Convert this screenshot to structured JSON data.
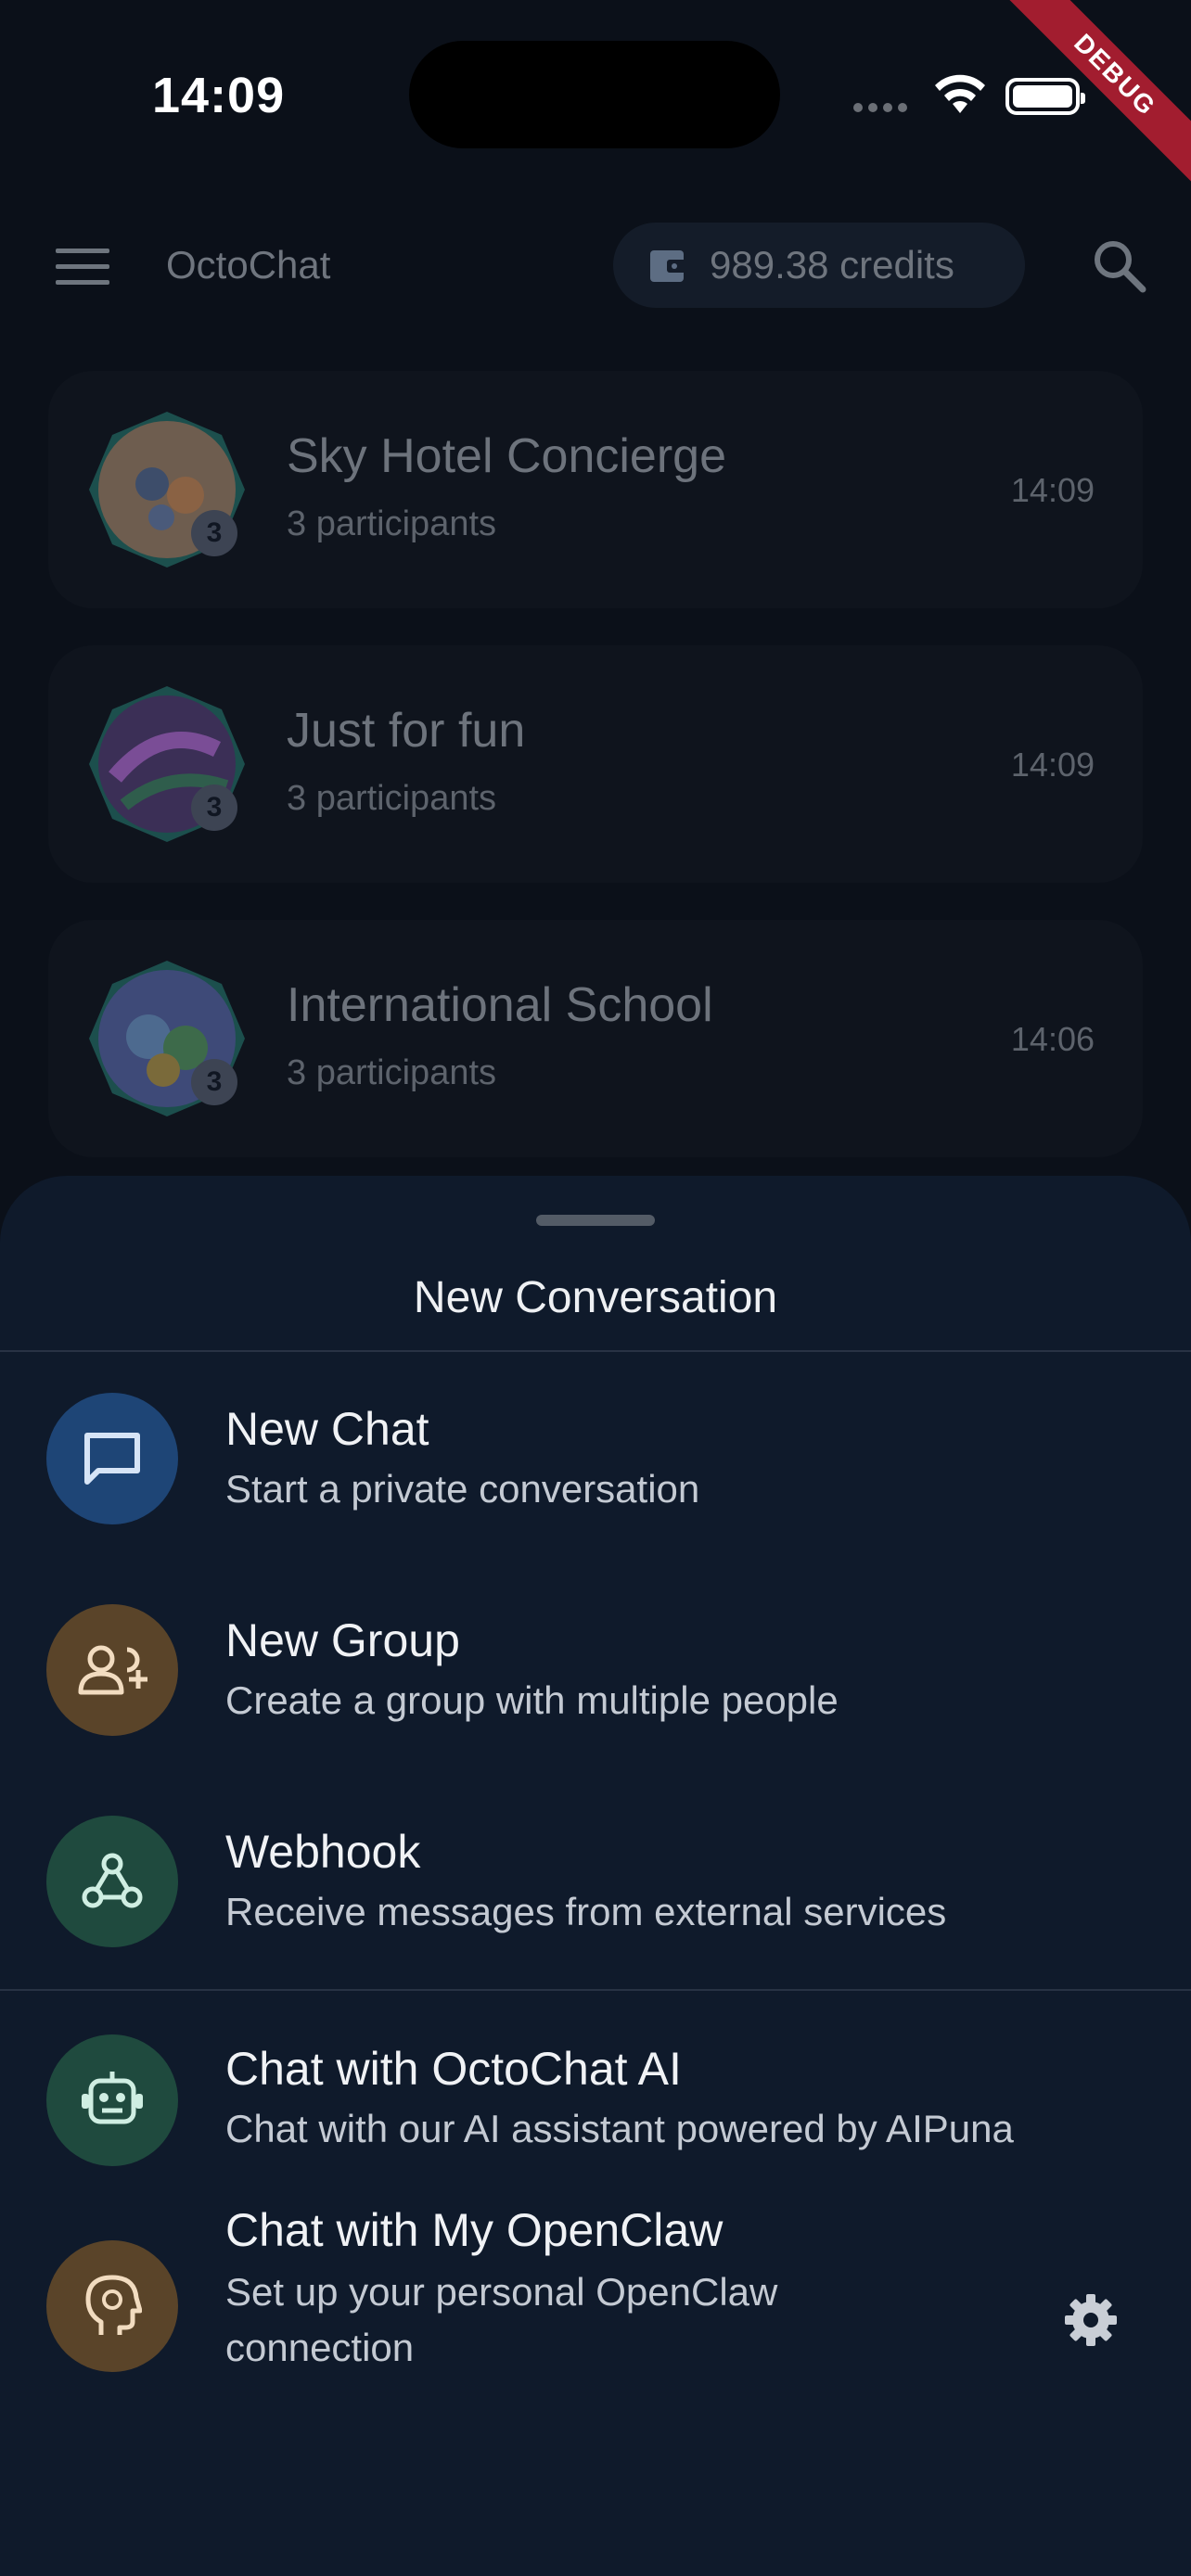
{
  "status_bar": {
    "time": "14:09",
    "debug_banner": "DEBUG"
  },
  "app_bar": {
    "title": "OctoChat",
    "credits": "989.38 credits",
    "icons": [
      "menu-icon",
      "wallet-icon",
      "search-icon"
    ]
  },
  "conversations": [
    {
      "name": "Sky Hotel Concierge",
      "participants": "3 participants",
      "time": "14:09",
      "badge": "3"
    },
    {
      "name": "Just for fun",
      "participants": "3 participants",
      "time": "14:09",
      "badge": "3"
    },
    {
      "name": "International School",
      "participants": "3 participants",
      "time": "14:06",
      "badge": "3"
    }
  ],
  "sheet": {
    "title": "New Conversation",
    "options": [
      {
        "title": "New Chat",
        "description": "Start a private conversation",
        "icon": "chat-bubble-icon",
        "color": "#1e4576"
      },
      {
        "title": "New Group",
        "description": "Create a group with multiple people",
        "icon": "add-group-icon",
        "color": "#5a4429"
      },
      {
        "title": "Webhook",
        "description": "Receive messages from external services",
        "icon": "webhook-icon",
        "color": "#1f4a3e"
      },
      {
        "title": "Chat with OctoChat AI",
        "description": "Chat with our AI assistant powered by AIPuna",
        "icon": "robot-icon",
        "color": "#1f4a3e"
      },
      {
        "title": "Chat with My OpenClaw",
        "description_line1": "Set up your personal OpenClaw",
        "description_line2": "connection",
        "icon": "psychology-head-icon",
        "color": "#5a4429"
      }
    ]
  },
  "colors": {
    "background": "#0b1019",
    "sheet": "#0f1a2b",
    "card": "#0f141d",
    "accent_blue": "#1e4576",
    "accent_brown": "#5a4429",
    "accent_green": "#1f4a3e"
  }
}
